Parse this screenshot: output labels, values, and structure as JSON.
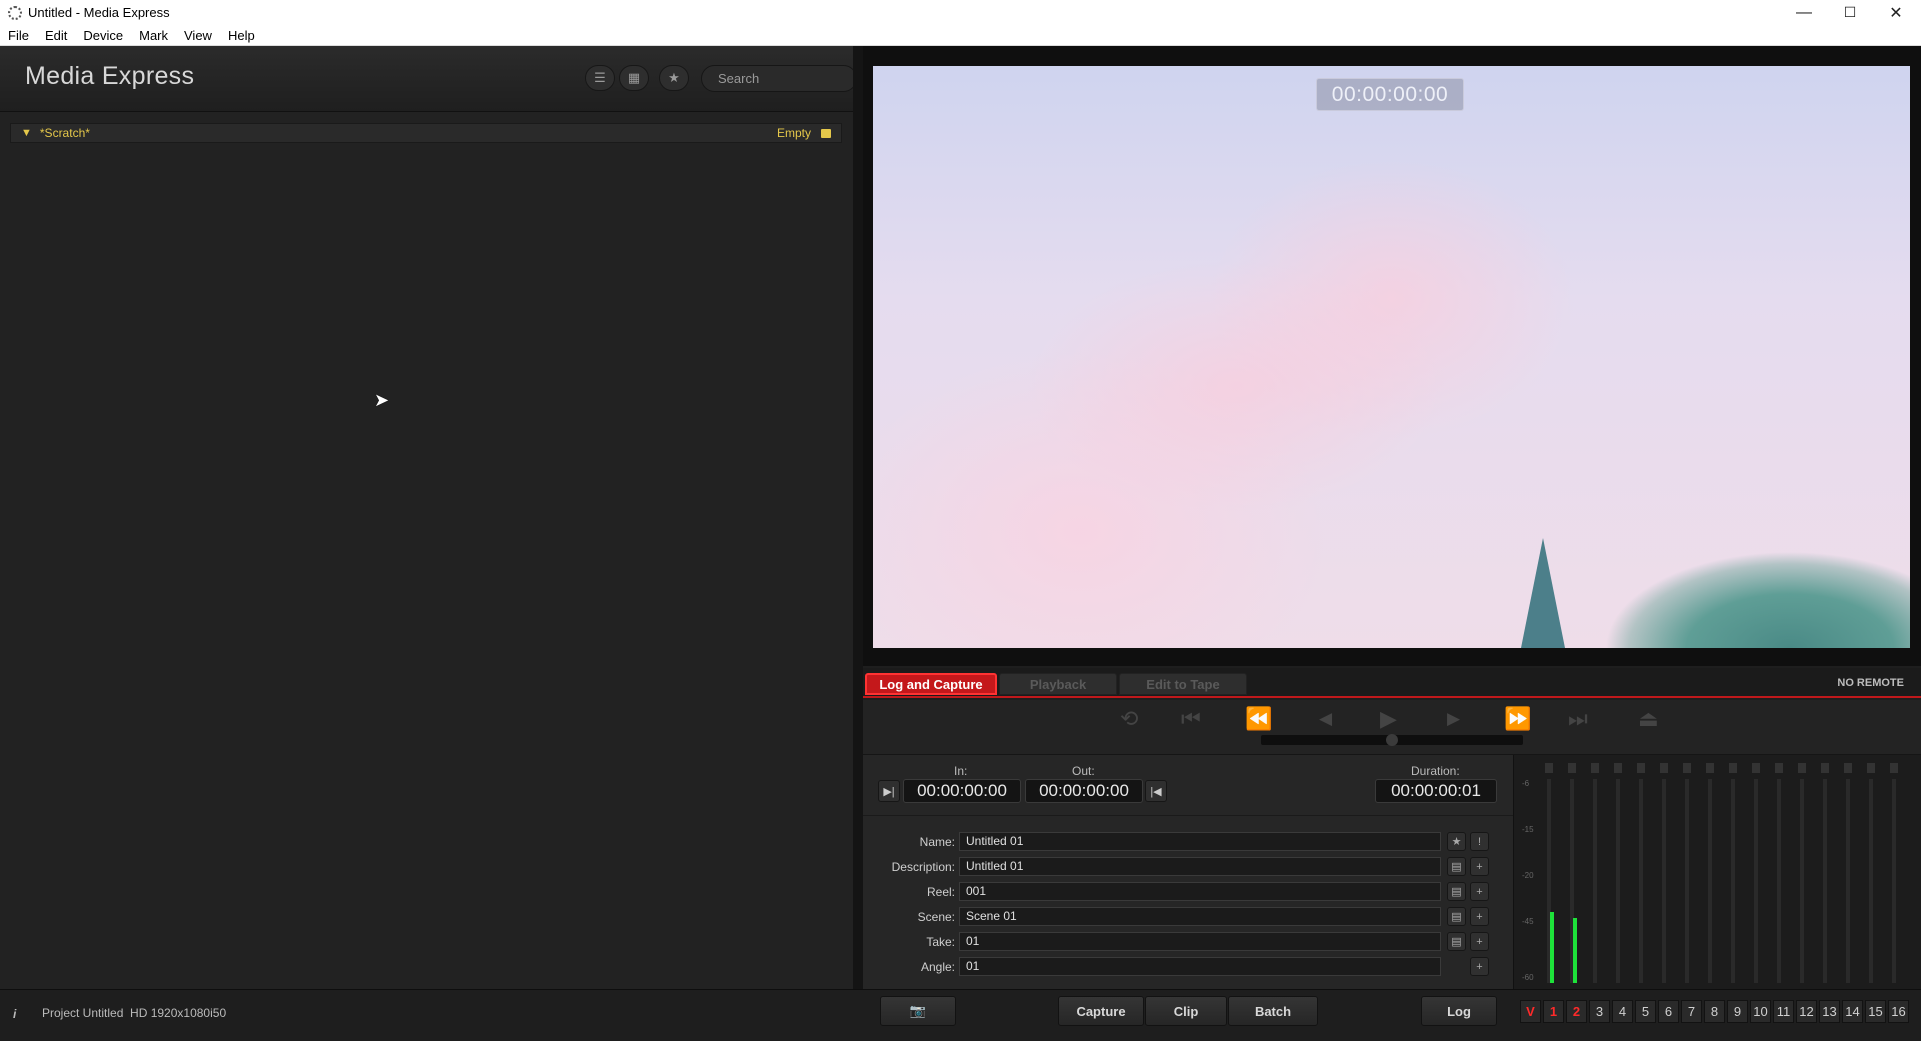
{
  "window": {
    "title": "Untitled - Media Express",
    "minimize": "—",
    "maximize": "☐",
    "close": "✕"
  },
  "menu": [
    "File",
    "Edit",
    "Device",
    "Mark",
    "View",
    "Help"
  ],
  "left": {
    "app_name": "Media Express",
    "search_placeholder": "Search",
    "bin": {
      "name": "*Scratch*",
      "status": "Empty"
    }
  },
  "video": {
    "timecode": "00:00:00:00"
  },
  "tabs": {
    "log_capture": "Log and Capture",
    "playback": "Playback",
    "edit_to_tape": "Edit to Tape",
    "remote_status": "NO REMOTE"
  },
  "transport": {
    "loop": "⟲",
    "to_start": "⏮",
    "rewind": "⏪",
    "step_back": "◀",
    "play": "▶",
    "step_fwd": "▶",
    "fast_fwd": "⏩",
    "to_end": "⏭",
    "eject": "⏏"
  },
  "log": {
    "in_label": "In:",
    "in_value": "00:00:00:00",
    "out_label": "Out:",
    "out_value": "00:00:00:00",
    "duration_label": "Duration:",
    "duration_value": "00:00:00:01",
    "fields": {
      "name_label": "Name:",
      "name_value": "Untitled 01",
      "desc_label": "Description:",
      "desc_value": "Untitled 01",
      "reel_label": "Reel:",
      "reel_value": "001",
      "scene_label": "Scene:",
      "scene_value": "Scene 01",
      "take_label": "Take:",
      "take_value": "01",
      "angle_label": "Angle:",
      "angle_value": "01"
    }
  },
  "meters": {
    "scale": [
      "-6",
      "-15",
      "-20",
      "-45",
      "-60"
    ],
    "levels": [
      0.35,
      0.32,
      0,
      0,
      0,
      0,
      0,
      0,
      0,
      0,
      0,
      0,
      0,
      0,
      0,
      0
    ]
  },
  "status": {
    "project": "Project Untitled",
    "format": "HD 1920x1080i50",
    "capture": "Capture",
    "clip": "Clip",
    "batch": "Batch",
    "log": "Log",
    "channels": [
      "V",
      "1",
      "2",
      "3",
      "4",
      "5",
      "6",
      "7",
      "8",
      "9",
      "10",
      "11",
      "12",
      "13",
      "14",
      "15",
      "16"
    ]
  },
  "colors": {
    "accent_red": "#c4181b",
    "bin_yellow": "#e5c84a",
    "meter_green": "#1ee23a"
  }
}
